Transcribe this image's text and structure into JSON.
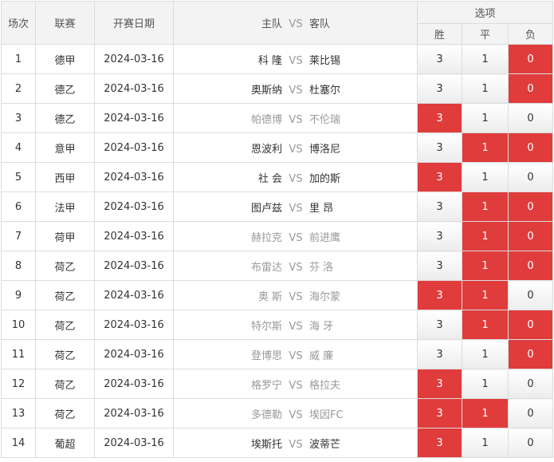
{
  "headers": {
    "round": "场次",
    "league": "联赛",
    "date": "开赛日期",
    "home": "主队",
    "vs": "VS",
    "away": "客队",
    "options": "选项",
    "win": "胜",
    "draw": "平",
    "lose": "负"
  },
  "colors": {
    "selected": "#e03c3c",
    "dim_team": "#999999"
  },
  "rows": [
    {
      "no": "1",
      "league": "德甲",
      "date": "2024-03-16",
      "home": "科 隆",
      "away": "莱比锡",
      "home_dim": false,
      "away_dim": false,
      "w": "3",
      "d": "1",
      "l": "0",
      "sel": [
        "l"
      ]
    },
    {
      "no": "2",
      "league": "德乙",
      "date": "2024-03-16",
      "home": "奥斯纳",
      "away": "杜塞尔",
      "home_dim": false,
      "away_dim": false,
      "w": "3",
      "d": "1",
      "l": "0",
      "sel": [
        "l"
      ]
    },
    {
      "no": "3",
      "league": "德乙",
      "date": "2024-03-16",
      "home": "帕德博",
      "away": "不伦瑞",
      "home_dim": true,
      "away_dim": true,
      "w": "3",
      "d": "1",
      "l": "0",
      "sel": [
        "w"
      ]
    },
    {
      "no": "4",
      "league": "意甲",
      "date": "2024-03-16",
      "home": "恩波利",
      "away": "博洛尼",
      "home_dim": false,
      "away_dim": false,
      "w": "3",
      "d": "1",
      "l": "0",
      "sel": [
        "d",
        "l"
      ]
    },
    {
      "no": "5",
      "league": "西甲",
      "date": "2024-03-16",
      "home": "社 会",
      "away": "加的斯",
      "home_dim": false,
      "away_dim": false,
      "w": "3",
      "d": "1",
      "l": "0",
      "sel": [
        "w"
      ]
    },
    {
      "no": "6",
      "league": "法甲",
      "date": "2024-03-16",
      "home": "图卢兹",
      "away": "里 昂",
      "home_dim": false,
      "away_dim": false,
      "w": "3",
      "d": "1",
      "l": "0",
      "sel": [
        "d",
        "l"
      ]
    },
    {
      "no": "7",
      "league": "荷甲",
      "date": "2024-03-16",
      "home": "赫拉克",
      "away": "前进鹰",
      "home_dim": true,
      "away_dim": true,
      "w": "3",
      "d": "1",
      "l": "0",
      "sel": [
        "d",
        "l"
      ]
    },
    {
      "no": "8",
      "league": "荷乙",
      "date": "2024-03-16",
      "home": "布雷达",
      "away": "芬 洛",
      "home_dim": true,
      "away_dim": true,
      "w": "3",
      "d": "1",
      "l": "0",
      "sel": [
        "d",
        "l"
      ]
    },
    {
      "no": "9",
      "league": "荷乙",
      "date": "2024-03-16",
      "home": "奥 斯",
      "away": "海尔蒙",
      "home_dim": true,
      "away_dim": true,
      "w": "3",
      "d": "1",
      "l": "0",
      "sel": [
        "w",
        "d"
      ]
    },
    {
      "no": "10",
      "league": "荷乙",
      "date": "2024-03-16",
      "home": "特尔斯",
      "away": "海 牙",
      "home_dim": true,
      "away_dim": true,
      "w": "3",
      "d": "1",
      "l": "0",
      "sel": [
        "d",
        "l"
      ]
    },
    {
      "no": "11",
      "league": "荷乙",
      "date": "2024-03-16",
      "home": "登博思",
      "away": "威 廉",
      "home_dim": true,
      "away_dim": true,
      "w": "3",
      "d": "1",
      "l": "0",
      "sel": [
        "l"
      ]
    },
    {
      "no": "12",
      "league": "荷乙",
      "date": "2024-03-16",
      "home": "格罗宁",
      "away": "格拉夫",
      "home_dim": true,
      "away_dim": true,
      "w": "3",
      "d": "1",
      "l": "0",
      "sel": [
        "w"
      ]
    },
    {
      "no": "13",
      "league": "荷乙",
      "date": "2024-03-16",
      "home": "多德勒",
      "away": "埃因FC",
      "home_dim": true,
      "away_dim": true,
      "w": "3",
      "d": "1",
      "l": "0",
      "sel": [
        "w",
        "d"
      ]
    },
    {
      "no": "14",
      "league": "葡超",
      "date": "2024-03-16",
      "home": "埃斯托",
      "away": "波蒂芒",
      "home_dim": false,
      "away_dim": false,
      "w": "3",
      "d": "1",
      "l": "0",
      "sel": [
        "w"
      ]
    }
  ]
}
